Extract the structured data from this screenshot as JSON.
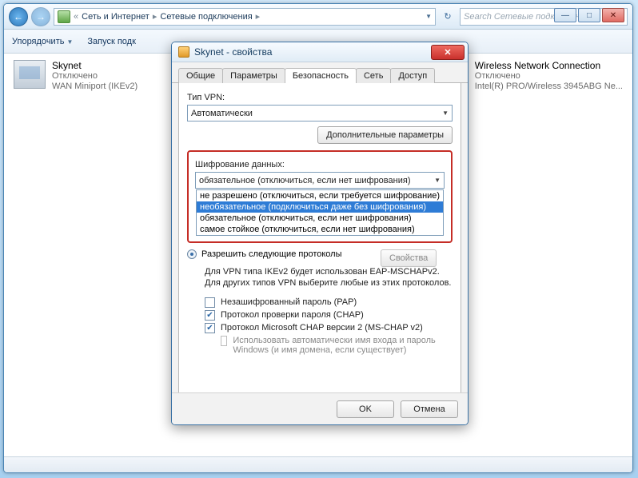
{
  "explorer": {
    "breadcrumbs": [
      "Сеть и Интернет",
      "Сетевые подключения"
    ],
    "search_placeholder": "Search Сетевые подключения",
    "toolbar": {
      "organize": "Упорядочить",
      "start": "Запуск подк"
    },
    "connections": [
      {
        "name": "Skynet",
        "status": "Отключено",
        "device": "WAN Miniport (IKEv2)"
      },
      {
        "name": "Wireless Network Connection",
        "status": "Отключено",
        "device": "Intel(R) PRO/Wireless 3945ABG Ne..."
      }
    ]
  },
  "dialog": {
    "title_prefix": "Skynet",
    "title_suffix": " - свойства",
    "tabs": [
      "Общие",
      "Параметры",
      "Безопасность",
      "Сеть",
      "Доступ"
    ],
    "active_tab": 2,
    "close_glyph": "✕",
    "vpn_type_label": "Тип VPN:",
    "vpn_type_value": "Автоматически",
    "adv_params": "Дополнительные параметры",
    "enc_label": "Шифрование данных:",
    "enc_value": "обязательное (отключиться, если нет шифрования)",
    "enc_options": [
      "не разрешено (отключиться, если требуется шифрование)",
      "необязательное (подключиться даже без шифрования)",
      "обязательное (отключиться, если нет шифрования)",
      "самое стойкое (отключиться, если нет шифрования)"
    ],
    "enc_highlight": 1,
    "allow_proto": "Разрешить следующие протоколы",
    "props_btn": "Свойства",
    "info_block": "Для VPN типа IKEv2 будет использован EAP-MSCHAPv2. Для других типов VPN выберите любые из этих протоколов.",
    "chk_pap": "Незашифрованный пароль (PAP)",
    "chk_chap": "Протокол проверки пароля (CHAP)",
    "chk_mschap": "Протокол Microsoft CHAP версии 2 (MS-CHAP v2)",
    "chk_auto": "Использовать автоматически имя входа и пароль Windows (и имя домена, если существует)",
    "chk_pap_checked": false,
    "chk_chap_checked": true,
    "chk_mschap_checked": true,
    "chk_auto_checked": false,
    "ok": "OK",
    "cancel": "Отмена"
  }
}
